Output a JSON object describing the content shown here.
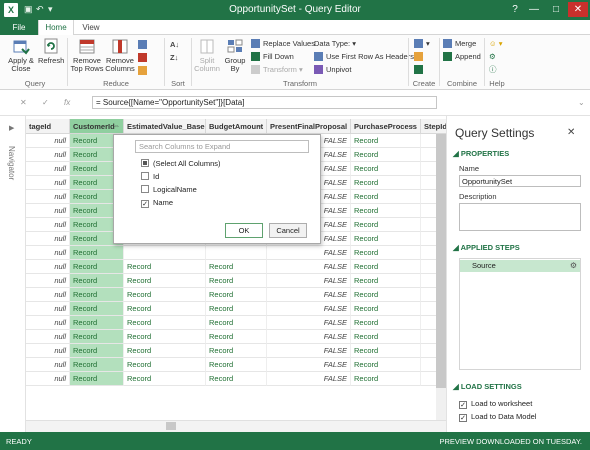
{
  "window": {
    "title": "OpportunitySet - Query Editor",
    "app_icon": "X",
    "colors": {
      "accent": "#217346",
      "selected_col": "#8fcf9f"
    }
  },
  "tabs": {
    "file": "File",
    "home": "Home",
    "view": "View"
  },
  "ribbon": {
    "query": {
      "label": "Query",
      "apply_close": "Apply & Close",
      "refresh": "Refresh"
    },
    "reduce": {
      "label": "Reduce",
      "remove_top_rows": "Remove Top Rows",
      "remove_columns": "Remove Columns"
    },
    "sort": {
      "label": "Sort"
    },
    "transform": {
      "label": "Transform",
      "split_column": "Split Column",
      "group_by": "Group By",
      "replace_values": "Replace Values",
      "fill_down": "Fill Down",
      "transform_menu": "Transform",
      "data_type": "Data Type:",
      "use_first_row": "Use First Row As Headers",
      "unpivot": "Unpivot"
    },
    "create": {
      "label": "Create"
    },
    "combine": {
      "label": "Combine",
      "merge": "Merge",
      "append": "Append"
    },
    "help": {
      "label": "Help"
    }
  },
  "formula": {
    "cancel": "✕",
    "accept": "✓",
    "fx": "fx",
    "text": "= Source{[Name=\"OpportunitySet\"]}[Data]"
  },
  "navigator": {
    "label": "Navigator",
    "arrow": "▶"
  },
  "grid": {
    "columns": [
      "tageId",
      "CustomerId",
      "EstimatedValue_Base",
      "BudgetAmount",
      "PresentFinalProposal",
      "PurchaseProcess",
      "StepId"
    ],
    "cell_null": "null",
    "cell_record": "Record",
    "cell_false": "FALSE",
    "expand_icon": "⇔"
  },
  "popup": {
    "search_placeholder": "Search Columns to Expand",
    "items": [
      {
        "label": "(Select All Columns)",
        "state": "partial"
      },
      {
        "label": "Id",
        "state": "off"
      },
      {
        "label": "LogicalName",
        "state": "off"
      },
      {
        "label": "Name",
        "state": "on"
      }
    ],
    "ok": "OK",
    "cancel": "Cancel"
  },
  "query_settings": {
    "title": "Query Settings",
    "properties": "PROPERTIES",
    "name_label": "Name",
    "name_value": "OpportunitySet",
    "description_label": "Description",
    "applied_steps": "APPLIED STEPS",
    "steps": [
      "Source"
    ],
    "load_settings": "LOAD SETTINGS",
    "load_worksheet": "Load to worksheet",
    "load_model": "Load to Data Model"
  },
  "status": {
    "left": "READY",
    "right": "PREVIEW DOWNLOADED ON TUESDAY."
  }
}
